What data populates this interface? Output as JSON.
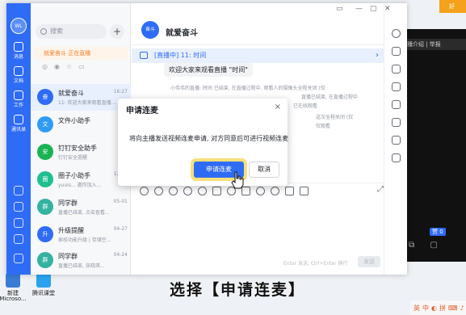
{
  "desktop": {
    "icons": [
      {
        "label": "新建",
        "color": "#3a7bd5"
      },
      {
        "label": "腾讯课堂",
        "color": "#2aa3ef"
      },
      {
        "label": "Microso...",
        "color": "#d24726"
      }
    ],
    "corner_logo": "好",
    "live_panel": {
      "bar_text": "播介绍 | 举报",
      "badge": "赞 0"
    }
  },
  "app": {
    "rail": {
      "avatar_text": "WL",
      "items": [
        {
          "label": "消息",
          "icon": "message-icon"
        },
        {
          "label": "文档",
          "icon": "document-icon"
        },
        {
          "label": "工作",
          "icon": "work-icon"
        },
        {
          "label": "通讯录",
          "icon": "contacts-icon"
        }
      ]
    },
    "list": {
      "search_placeholder": "搜索",
      "plus_label": "+",
      "live_note": "就爱奋斗 正在直播",
      "conversations": [
        {
          "name": "就爱奋斗",
          "preview": "11: 欢迎大家来观看直播...",
          "time": "16:27",
          "color": "#2f6cf6",
          "avatar": "奋",
          "active": true
        },
        {
          "name": "文件小助手",
          "preview": "",
          "time": "",
          "color": "#2f9bf6",
          "avatar": "文",
          "active": false
        },
        {
          "name": "钉钉安全助手",
          "preview": "钉钉安全提醒",
          "time": "",
          "color": "#19b354",
          "avatar": "安",
          "active": false
        },
        {
          "name": "圈子小助手",
          "preview": "yuuis... 邀你加入...",
          "time": "12:35",
          "color": "#1fbf8f",
          "avatar": "圈",
          "active": false
        },
        {
          "name": "同学群",
          "preview": "直播已结束, 点击查看...",
          "time": "05-01",
          "color": "#34b3a0",
          "avatar": "群",
          "active": false
        },
        {
          "name": "升级提醒",
          "preview": "家校功能升级 | 存储空...",
          "time": "04-27",
          "color": "#2f6cf6",
          "avatar": "升",
          "active": false
        },
        {
          "name": "同学群",
          "preview": "直播已结束, 张晓琪...",
          "time": "04-24",
          "color": "#34b3a0",
          "avatar": "群",
          "active": false
        }
      ]
    },
    "chat": {
      "title": "就爱奋斗",
      "header_avatar": "奋斗",
      "live_banner": "[直播中] 11: 时间",
      "welcome": "欢迎大家来观看直播 \"时间\"",
      "sys_lines": [
        "小伟伟的直播: 时间 已结束, 在直播过程中, 观看人的摄像头全程关闭 (仅",
        "直播已结束, 在直播过程中",
        "已在线观看",
        "这次全程关闭 (仅",
        "仅观看"
      ],
      "composer_hint": "Enter 发送, Ctrl+Enter 换行",
      "send_label": "发送"
    }
  },
  "dialog": {
    "title": "申请连麦",
    "close": "×",
    "body": "将向主播发送视频连麦申请, 对方同意后可进行视频连麦",
    "primary": "申请连麦",
    "cancel": "取消"
  },
  "subtitle": "选择【申请连麦】",
  "tray": [
    "英",
    "中",
    "◐",
    "拼",
    "⌨",
    "♪"
  ]
}
